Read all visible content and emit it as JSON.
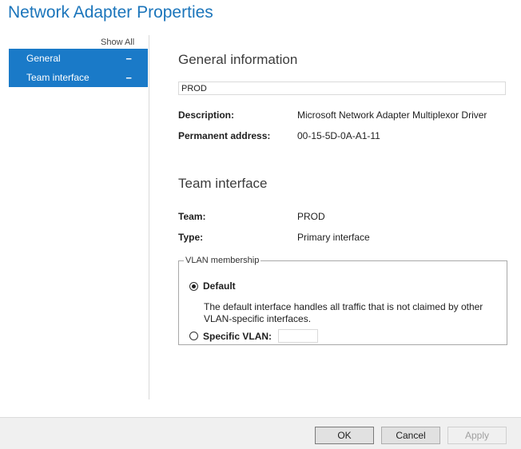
{
  "window": {
    "title": "Network Adapter Properties"
  },
  "sidebar": {
    "show_all": "Show All",
    "items": [
      {
        "label": "General",
        "toggle": "−"
      },
      {
        "label": "Team interface",
        "toggle": "−"
      }
    ]
  },
  "general": {
    "heading": "General information",
    "name_value": "PROD",
    "description_label": "Description:",
    "description_value": "Microsoft Network Adapter Multiplexor Driver",
    "address_label": "Permanent address:",
    "address_value": "00-15-5D-0A-A1-11"
  },
  "team_interface": {
    "heading": "Team interface",
    "team_label": "Team:",
    "team_value": "PROD",
    "type_label": "Type:",
    "type_value": "Primary interface",
    "vlan": {
      "legend": "VLAN membership",
      "default_label": "Default",
      "default_checked": true,
      "default_description": "The default interface handles all traffic that is not claimed by other VLAN-specific interfaces.",
      "specific_label": "Specific VLAN:",
      "specific_checked": false,
      "specific_value": ""
    }
  },
  "footer": {
    "ok_label": "OK",
    "cancel_label": "Cancel",
    "apply_label": "Apply"
  },
  "colors": {
    "accent": "#1a7ac8",
    "title": "#1b75bb"
  }
}
